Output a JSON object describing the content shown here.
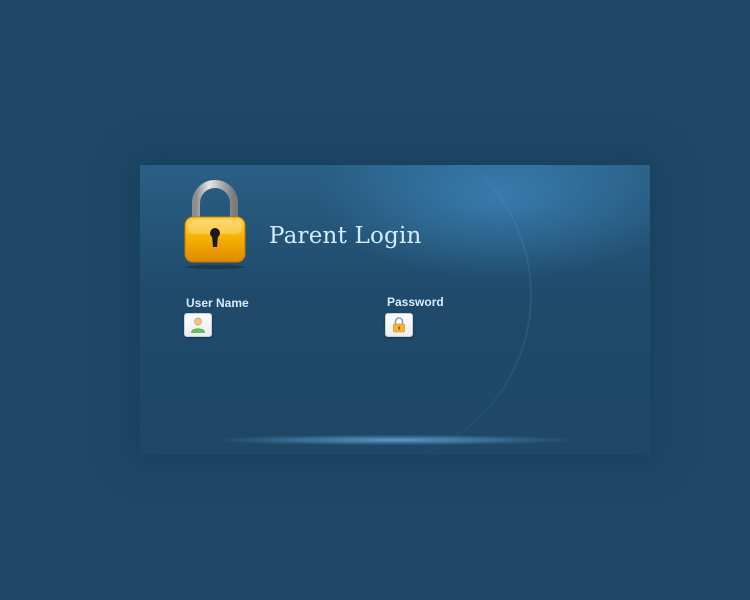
{
  "login": {
    "title": "Parent Login",
    "username": {
      "label": "User Name",
      "value": "",
      "icon": "user-icon"
    },
    "password": {
      "label": "Password",
      "value": "",
      "icon": "padlock-icon"
    }
  },
  "colors": {
    "background": "#1f4866",
    "panel_highlight": "#4696d2",
    "title_text": "#d3ebfa",
    "label_text": "#d9ecf8",
    "lock_body": "#f6a800",
    "lock_shackle": "#b8b8b8"
  }
}
